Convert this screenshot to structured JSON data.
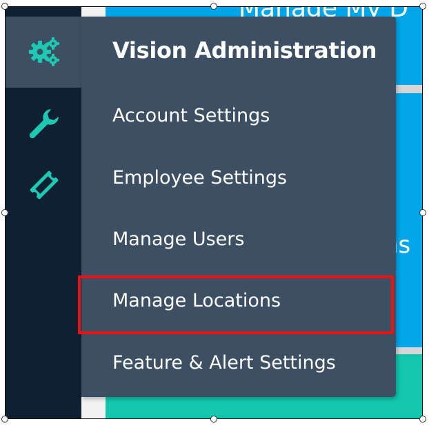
{
  "background": {
    "heading_fragment": "Manage My D",
    "mid_fragment": "ns",
    "colors": {
      "blue": "#00a6e9",
      "teal": "#12c7ad"
    }
  },
  "sidebar": {
    "icons": [
      "gears-icon",
      "wrench-icon",
      "ticket-icon"
    ],
    "icon_color": "#1ec9b3"
  },
  "menu": {
    "title": "Vision Administration",
    "items": [
      {
        "label": "Account Settings"
      },
      {
        "label": "Employee Settings"
      },
      {
        "label": "Manage Users"
      },
      {
        "label": "Manage Locations",
        "highlighted": true
      },
      {
        "label": "Feature & Alert Settings"
      }
    ]
  },
  "annotation": {
    "highlight_color": "#ee1111"
  }
}
